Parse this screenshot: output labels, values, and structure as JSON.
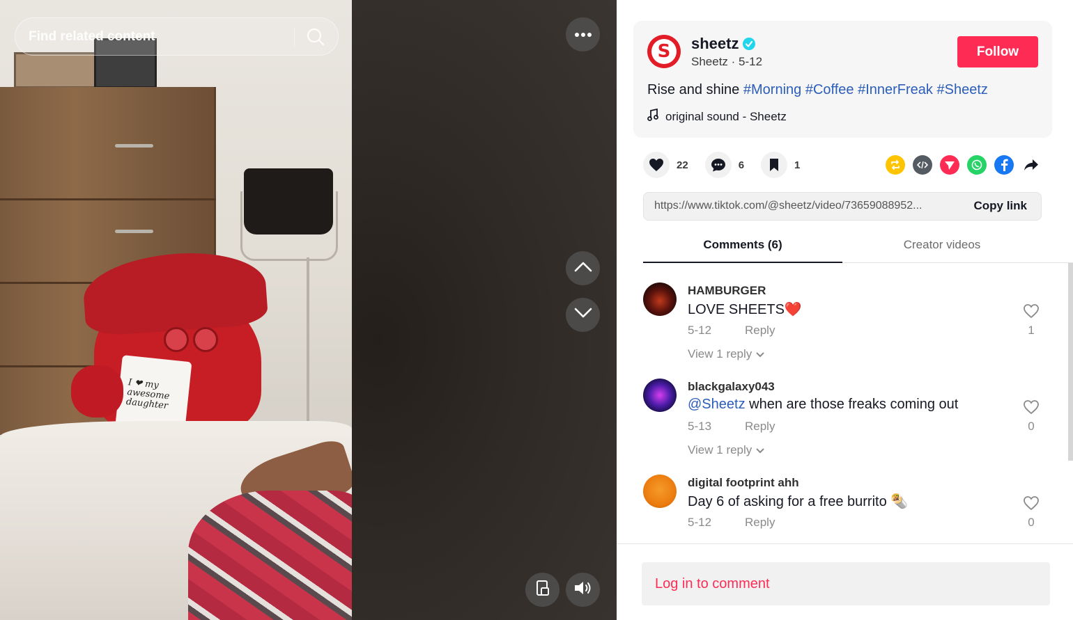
{
  "search": {
    "placeholder": "Find related content"
  },
  "video": {
    "mug_line1": "I ❤ my",
    "mug_line2": "awesome",
    "mug_line3": "daughter"
  },
  "post": {
    "avatar_letter": "S",
    "username": "sheetz",
    "display_name": "Sheetz",
    "date": "5-12",
    "follow_label": "Follow",
    "caption_text": "Rise and shine",
    "hashtags": [
      "#Morning",
      "#Coffee",
      "#InnerFreak",
      "#Sheetz"
    ],
    "sound": "original sound - Sheetz"
  },
  "actions": {
    "likes": "22",
    "comments": "6",
    "saves": "1"
  },
  "share": {
    "link": "https://www.tiktok.com/@sheetz/video/73659088952...",
    "copy_label": "Copy link"
  },
  "tabs": {
    "comments": "Comments (6)",
    "creator": "Creator videos"
  },
  "comments": [
    {
      "user": "HAMBURGER",
      "text": "LOVE SHEETS❤️",
      "date": "5-12",
      "reply": "Reply",
      "view_replies": "View 1 reply",
      "likes": "1"
    },
    {
      "user": "blackgalaxy043",
      "mention": "@Sheetz",
      "text": " when are those freaks coming out",
      "date": "5-13",
      "reply": "Reply",
      "view_replies": "View 1 reply",
      "likes": "0"
    },
    {
      "user": "digital footprint ahh",
      "text": "Day 6 of asking for a free burrito 🌯",
      "date": "5-12",
      "reply": "Reply",
      "likes": "0"
    }
  ],
  "login": {
    "label": "Log in to comment"
  },
  "colors": {
    "accent": "#fe2c55",
    "hashtag": "#2b5db9",
    "brand": "#e31d27"
  }
}
